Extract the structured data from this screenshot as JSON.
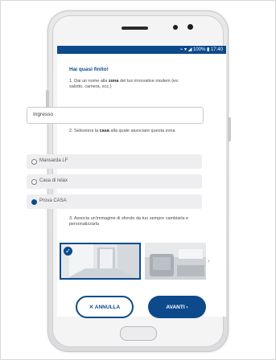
{
  "status_bar": {
    "text": "⌁ ▾ ◢ 100% ▮ 17:40"
  },
  "form": {
    "title": "Hai quasi finito!",
    "q1": {
      "num": "1.",
      "before": "Dai un nome alla",
      "bold": "zona",
      "after": "del tuo innovative modem (es: salotto, camera, ecc.)"
    },
    "zone_input_value": "Ingresso",
    "q2": {
      "num": "2.",
      "before": "Seleziona la",
      "bold": "casa",
      "after": "alla quale associare questa zona"
    },
    "options": [
      {
        "label": "Mansarda LF",
        "selected": false
      },
      {
        "label": "Casa di relax",
        "selected": false
      },
      {
        "label": "Prova CASA",
        "selected": true
      }
    ],
    "q3": {
      "num": "3.",
      "text": "Associa un'immagine di sfondo da tuo sempre cambiarla e personalizzarla"
    },
    "carousel_next": "›",
    "cancel_label": "✕ ANNULLA",
    "next_label": "AVANTI ›"
  },
  "colors": {
    "accent": "#0d4a8c",
    "option_bg": "#eeeef0"
  },
  "icons": {
    "selected_check": "✓"
  }
}
